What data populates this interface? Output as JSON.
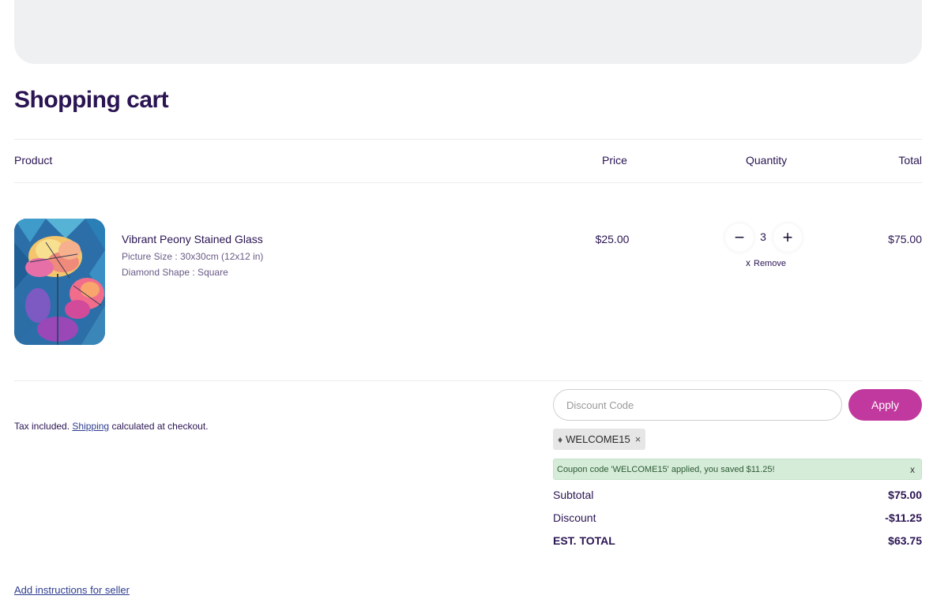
{
  "page": {
    "title": "Shopping cart"
  },
  "table": {
    "headers": {
      "product": "Product",
      "price": "Price",
      "quantity": "Quantity",
      "total": "Total"
    }
  },
  "item": {
    "title": "Vibrant Peony Stained Glass",
    "options": [
      "Picture Size : 30x30cm (12x12 in)",
      "Diamond Shape : Square"
    ],
    "price": "$25.00",
    "quantity": "3",
    "total": "$75.00",
    "remove_label": "Remove",
    "remove_glyph": "x",
    "minus_glyph": "−",
    "plus_glyph": "+"
  },
  "footer_note": {
    "prefix": "Tax included.",
    "link": "Shipping",
    "suffix": "calculated at checkout."
  },
  "discount": {
    "placeholder": "Discount Code",
    "apply_label": "Apply",
    "coupon_code": "WELCOME15",
    "coupon_remove_glyph": "×",
    "alert_message": "Coupon code 'WELCOME15' applied, you saved $11.25!",
    "alert_close_glyph": "x"
  },
  "summary": {
    "subtotal_label": "Subtotal",
    "subtotal_value": "$75.00",
    "discount_label": "Discount",
    "discount_value": "-$11.25",
    "total_label": "EST. TOTAL",
    "total_value": "$63.75"
  },
  "seller_instructions_link": "Add instructions for seller",
  "colors": {
    "accent": "#c1399e",
    "text": "#2a1452",
    "success_bg": "#d5ecd9"
  }
}
